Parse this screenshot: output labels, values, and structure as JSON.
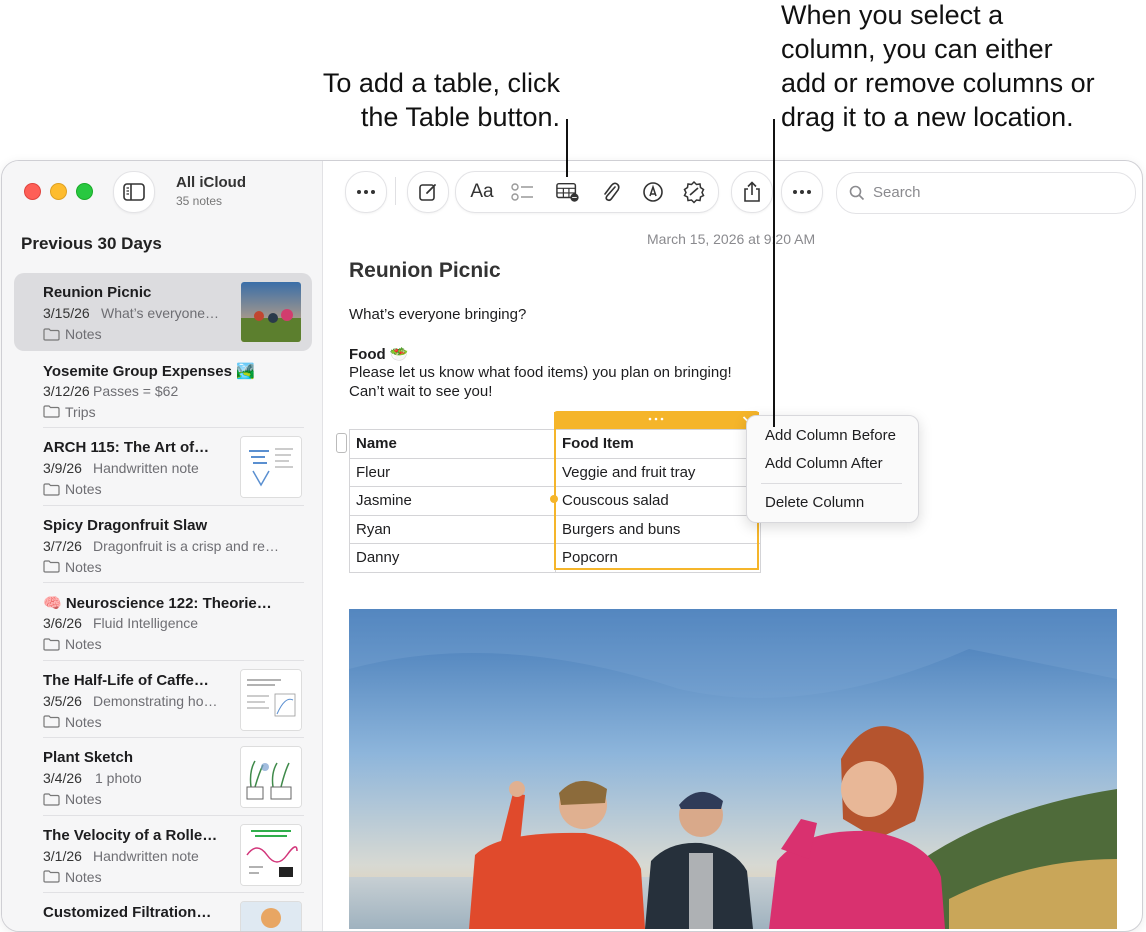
{
  "callouts": {
    "left": [
      "To add a table, click",
      "the Table button."
    ],
    "right": [
      "When you select a",
      "column, you can either",
      "add or remove columns or",
      "drag it to a new location."
    ]
  },
  "window": {
    "folder_title": "All iCloud",
    "folder_count": "35 notes",
    "search_placeholder": "Search"
  },
  "sidebar": {
    "section_title": "Previous 30 Days",
    "notes": [
      {
        "title": "Reunion Picnic",
        "date": "3/15/26",
        "preview": "What’s everyone…",
        "folder": "Notes"
      },
      {
        "title": "Yosemite Group Expenses 🏞️",
        "date": "3/12/26",
        "preview": "Passes = $62",
        "folder": "Trips"
      },
      {
        "title": "ARCH 115: The Art of…",
        "date": "3/9/26",
        "preview": "Handwritten note",
        "folder": "Notes"
      },
      {
        "title": "Spicy Dragonfruit Slaw",
        "date": "3/7/26",
        "preview": "Dragonfruit is a crisp and re…",
        "folder": "Notes"
      },
      {
        "title": "🧠 Neuroscience 122: Theorie…",
        "date": "3/6/26",
        "preview": "Fluid Intelligence",
        "folder": "Notes"
      },
      {
        "title": "The Half-Life of Caffe…",
        "date": "3/5/26",
        "preview": "Demonstrating ho…",
        "folder": "Notes"
      },
      {
        "title": "Plant Sketch",
        "date": "3/4/26",
        "preview": "1 photo",
        "folder": "Notes"
      },
      {
        "title": "The Velocity of a Rolle…",
        "date": "3/1/26",
        "preview": "Handwritten note",
        "folder": "Notes"
      },
      {
        "title": "Customized Filtration…",
        "date": "",
        "preview": "",
        "folder": ""
      }
    ]
  },
  "note": {
    "timestamp": "March 15, 2026 at 9:20 AM",
    "title": "Reunion Picnic",
    "question": "What’s everyone bringing?",
    "food_heading": "Food 🥗",
    "line1": "Please let us know what food items) you plan on bringing!",
    "line2": "Can’t wait to see you!",
    "table": {
      "headers": [
        "Name",
        "Food Item"
      ],
      "rows": [
        [
          "Fleur",
          "Veggie and fruit tray"
        ],
        [
          "Jasmine",
          "Couscous salad"
        ],
        [
          "Ryan",
          "Burgers and buns"
        ],
        [
          "Danny",
          "Popcorn"
        ]
      ]
    }
  },
  "column_menu": {
    "items": [
      "Add Column Before",
      "Add Column After",
      "Delete Column"
    ]
  },
  "colors": {
    "selection": "#f5b52a",
    "selected_row": "#dcdcdf"
  }
}
